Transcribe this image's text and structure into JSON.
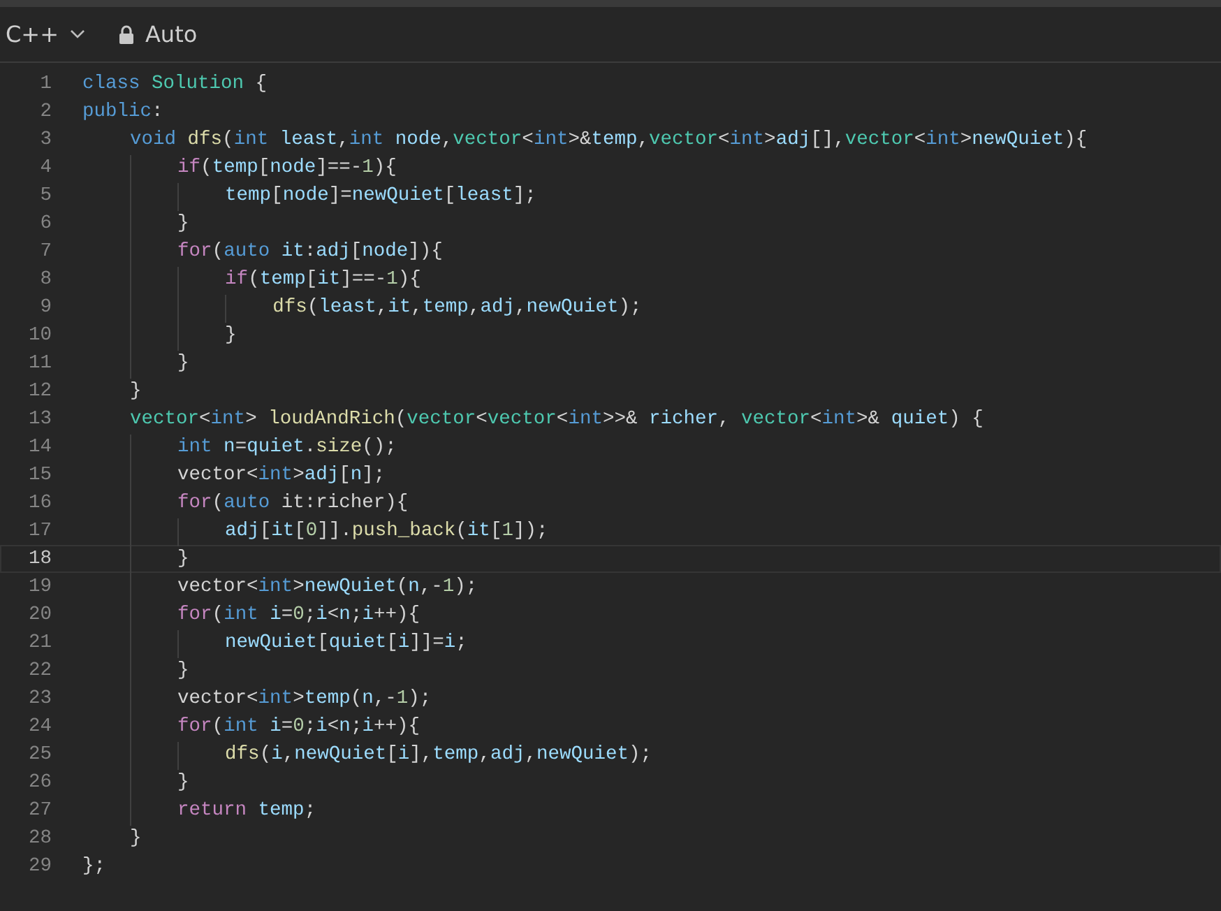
{
  "toolbar": {
    "language": "C++",
    "mode": "Auto"
  },
  "lines": [
    {
      "number": "1",
      "current": false,
      "tokens": [
        {
          "text": "class",
          "kind": "keyword"
        },
        {
          "text": " Solution",
          "kind": "type"
        },
        {
          "text": " {",
          "kind": "plain"
        }
      ]
    },
    {
      "number": "2",
      "current": false,
      "tokens": [
        {
          "text": "public",
          "kind": "keyword"
        },
        {
          "text": ":",
          "kind": "plain"
        }
      ]
    },
    {
      "number": "3",
      "current": false,
      "tokens": [
        {
          "text": "    void",
          "kind": "keyword"
        },
        {
          "text": " dfs",
          "kind": "function"
        },
        {
          "text": "(",
          "kind": "plain"
        },
        {
          "text": "int",
          "kind": "keyword"
        },
        {
          "text": " least",
          "kind": "variable"
        },
        {
          "text": ",",
          "kind": "plain"
        },
        {
          "text": "int",
          "kind": "keyword"
        },
        {
          "text": " node",
          "kind": "variable"
        },
        {
          "text": ",",
          "kind": "plain"
        },
        {
          "text": "vector",
          "kind": "type"
        },
        {
          "text": "<",
          "kind": "plain"
        },
        {
          "text": "int",
          "kind": "keyword"
        },
        {
          "text": ">&",
          "kind": "plain"
        },
        {
          "text": "temp",
          "kind": "variable"
        },
        {
          "text": ",",
          "kind": "plain"
        },
        {
          "text": "vector",
          "kind": "type"
        },
        {
          "text": "<",
          "kind": "plain"
        },
        {
          "text": "int",
          "kind": "keyword"
        },
        {
          "text": ">",
          "kind": "plain"
        },
        {
          "text": "adj",
          "kind": "variable"
        },
        {
          "text": "[],",
          "kind": "plain"
        },
        {
          "text": "vector",
          "kind": "type"
        },
        {
          "text": "<",
          "kind": "plain"
        },
        {
          "text": "int",
          "kind": "keyword"
        },
        {
          "text": ">",
          "kind": "plain"
        },
        {
          "text": "newQuiet",
          "kind": "variable"
        },
        {
          "text": "){",
          "kind": "plain"
        }
      ]
    },
    {
      "number": "4",
      "current": false,
      "tokens": [
        {
          "text": "        if",
          "kind": "control"
        },
        {
          "text": "(",
          "kind": "plain"
        },
        {
          "text": "temp",
          "kind": "variable"
        },
        {
          "text": "[",
          "kind": "plain"
        },
        {
          "text": "node",
          "kind": "variable"
        },
        {
          "text": "]==-",
          "kind": "plain"
        },
        {
          "text": "1",
          "kind": "number"
        },
        {
          "text": "){",
          "kind": "plain"
        }
      ]
    },
    {
      "number": "5",
      "current": false,
      "tokens": [
        {
          "text": "            temp",
          "kind": "variable"
        },
        {
          "text": "[",
          "kind": "plain"
        },
        {
          "text": "node",
          "kind": "variable"
        },
        {
          "text": "]=",
          "kind": "plain"
        },
        {
          "text": "newQuiet",
          "kind": "variable"
        },
        {
          "text": "[",
          "kind": "plain"
        },
        {
          "text": "least",
          "kind": "variable"
        },
        {
          "text": "];",
          "kind": "plain"
        }
      ]
    },
    {
      "number": "6",
      "current": false,
      "tokens": [
        {
          "text": "        }",
          "kind": "plain"
        }
      ]
    },
    {
      "number": "7",
      "current": false,
      "tokens": [
        {
          "text": "        for",
          "kind": "control"
        },
        {
          "text": "(",
          "kind": "plain"
        },
        {
          "text": "auto",
          "kind": "keyword"
        },
        {
          "text": " it",
          "kind": "variable"
        },
        {
          "text": ":",
          "kind": "plain"
        },
        {
          "text": "adj",
          "kind": "variable"
        },
        {
          "text": "[",
          "kind": "plain"
        },
        {
          "text": "node",
          "kind": "variable"
        },
        {
          "text": "]){",
          "kind": "plain"
        }
      ]
    },
    {
      "number": "8",
      "current": false,
      "tokens": [
        {
          "text": "            if",
          "kind": "control"
        },
        {
          "text": "(",
          "kind": "plain"
        },
        {
          "text": "temp",
          "kind": "variable"
        },
        {
          "text": "[",
          "kind": "plain"
        },
        {
          "text": "it",
          "kind": "variable"
        },
        {
          "text": "]==-",
          "kind": "plain"
        },
        {
          "text": "1",
          "kind": "number"
        },
        {
          "text": "){",
          "kind": "plain"
        }
      ]
    },
    {
      "number": "9",
      "current": false,
      "tokens": [
        {
          "text": "                dfs",
          "kind": "function"
        },
        {
          "text": "(",
          "kind": "plain"
        },
        {
          "text": "least",
          "kind": "variable"
        },
        {
          "text": ",",
          "kind": "plain"
        },
        {
          "text": "it",
          "kind": "variable"
        },
        {
          "text": ",",
          "kind": "plain"
        },
        {
          "text": "temp",
          "kind": "variable"
        },
        {
          "text": ",",
          "kind": "plain"
        },
        {
          "text": "adj",
          "kind": "variable"
        },
        {
          "text": ",",
          "kind": "plain"
        },
        {
          "text": "newQuiet",
          "kind": "variable"
        },
        {
          "text": ");",
          "kind": "plain"
        }
      ]
    },
    {
      "number": "10",
      "current": false,
      "tokens": [
        {
          "text": "            }",
          "kind": "plain"
        }
      ]
    },
    {
      "number": "11",
      "current": false,
      "tokens": [
        {
          "text": "        }",
          "kind": "plain"
        }
      ]
    },
    {
      "number": "12",
      "current": false,
      "tokens": [
        {
          "text": "    }",
          "kind": "plain"
        }
      ]
    },
    {
      "number": "13",
      "current": false,
      "tokens": [
        {
          "text": "    vector",
          "kind": "type"
        },
        {
          "text": "<",
          "kind": "plain"
        },
        {
          "text": "int",
          "kind": "keyword"
        },
        {
          "text": ">",
          "kind": "plain"
        },
        {
          "text": " loudAndRich",
          "kind": "function"
        },
        {
          "text": "(",
          "kind": "plain"
        },
        {
          "text": "vector",
          "kind": "type"
        },
        {
          "text": "<",
          "kind": "plain"
        },
        {
          "text": "vector",
          "kind": "type"
        },
        {
          "text": "<",
          "kind": "plain"
        },
        {
          "text": "int",
          "kind": "keyword"
        },
        {
          "text": ">>&",
          "kind": "plain"
        },
        {
          "text": " richer",
          "kind": "variable"
        },
        {
          "text": ",",
          "kind": "plain"
        },
        {
          "text": " vector",
          "kind": "type"
        },
        {
          "text": "<",
          "kind": "plain"
        },
        {
          "text": "int",
          "kind": "keyword"
        },
        {
          "text": ">&",
          "kind": "plain"
        },
        {
          "text": " quiet",
          "kind": "variable"
        },
        {
          "text": ") {",
          "kind": "plain"
        }
      ]
    },
    {
      "number": "14",
      "current": false,
      "tokens": [
        {
          "text": "        int",
          "kind": "keyword"
        },
        {
          "text": " n",
          "kind": "variable"
        },
        {
          "text": "=",
          "kind": "plain"
        },
        {
          "text": "quiet",
          "kind": "variable"
        },
        {
          "text": ".",
          "kind": "plain"
        },
        {
          "text": "size",
          "kind": "function"
        },
        {
          "text": "();",
          "kind": "plain"
        }
      ]
    },
    {
      "number": "15",
      "current": false,
      "tokens": [
        {
          "text": "        vector<",
          "kind": "plain"
        },
        {
          "text": "int",
          "kind": "keyword"
        },
        {
          "text": ">",
          "kind": "plain"
        },
        {
          "text": "adj",
          "kind": "variable"
        },
        {
          "text": "[",
          "kind": "plain"
        },
        {
          "text": "n",
          "kind": "variable"
        },
        {
          "text": "];",
          "kind": "plain"
        }
      ]
    },
    {
      "number": "16",
      "current": false,
      "tokens": [
        {
          "text": "        for",
          "kind": "control"
        },
        {
          "text": "(",
          "kind": "plain"
        },
        {
          "text": "auto",
          "kind": "keyword"
        },
        {
          "text": " it:richer){",
          "kind": "plain"
        }
      ]
    },
    {
      "number": "17",
      "current": false,
      "tokens": [
        {
          "text": "            adj",
          "kind": "variable"
        },
        {
          "text": "[",
          "kind": "plain"
        },
        {
          "text": "it",
          "kind": "variable"
        },
        {
          "text": "[",
          "kind": "plain"
        },
        {
          "text": "0",
          "kind": "number"
        },
        {
          "text": "]].",
          "kind": "plain"
        },
        {
          "text": "push_back",
          "kind": "function"
        },
        {
          "text": "(",
          "kind": "plain"
        },
        {
          "text": "it",
          "kind": "variable"
        },
        {
          "text": "[",
          "kind": "plain"
        },
        {
          "text": "1",
          "kind": "number"
        },
        {
          "text": "]);",
          "kind": "plain"
        }
      ]
    },
    {
      "number": "18",
      "current": true,
      "tokens": [
        {
          "text": "        }",
          "kind": "plain"
        }
      ]
    },
    {
      "number": "19",
      "current": false,
      "tokens": [
        {
          "text": "        vector<",
          "kind": "plain"
        },
        {
          "text": "int",
          "kind": "keyword"
        },
        {
          "text": ">",
          "kind": "plain"
        },
        {
          "text": "newQuiet",
          "kind": "variable"
        },
        {
          "text": "(",
          "kind": "plain"
        },
        {
          "text": "n",
          "kind": "variable"
        },
        {
          "text": ",-",
          "kind": "plain"
        },
        {
          "text": "1",
          "kind": "number"
        },
        {
          "text": ");",
          "kind": "plain"
        }
      ]
    },
    {
      "number": "20",
      "current": false,
      "tokens": [
        {
          "text": "        for",
          "kind": "control"
        },
        {
          "text": "(",
          "kind": "plain"
        },
        {
          "text": "int",
          "kind": "keyword"
        },
        {
          "text": " i",
          "kind": "variable"
        },
        {
          "text": "=",
          "kind": "plain"
        },
        {
          "text": "0",
          "kind": "number"
        },
        {
          "text": ";",
          "kind": "plain"
        },
        {
          "text": "i",
          "kind": "variable"
        },
        {
          "text": "<",
          "kind": "plain"
        },
        {
          "text": "n",
          "kind": "variable"
        },
        {
          "text": ";",
          "kind": "plain"
        },
        {
          "text": "i",
          "kind": "variable"
        },
        {
          "text": "++){",
          "kind": "plain"
        }
      ]
    },
    {
      "number": "21",
      "current": false,
      "tokens": [
        {
          "text": "            newQuiet",
          "kind": "variable"
        },
        {
          "text": "[",
          "kind": "plain"
        },
        {
          "text": "quiet",
          "kind": "variable"
        },
        {
          "text": "[",
          "kind": "plain"
        },
        {
          "text": "i",
          "kind": "variable"
        },
        {
          "text": "]]=",
          "kind": "plain"
        },
        {
          "text": "i",
          "kind": "variable"
        },
        {
          "text": ";",
          "kind": "plain"
        }
      ]
    },
    {
      "number": "22",
      "current": false,
      "tokens": [
        {
          "text": "        }",
          "kind": "plain"
        }
      ]
    },
    {
      "number": "23",
      "current": false,
      "tokens": [
        {
          "text": "        vector<",
          "kind": "plain"
        },
        {
          "text": "int",
          "kind": "keyword"
        },
        {
          "text": ">",
          "kind": "plain"
        },
        {
          "text": "temp",
          "kind": "variable"
        },
        {
          "text": "(",
          "kind": "plain"
        },
        {
          "text": "n",
          "kind": "variable"
        },
        {
          "text": ",-",
          "kind": "plain"
        },
        {
          "text": "1",
          "kind": "number"
        },
        {
          "text": ");",
          "kind": "plain"
        }
      ]
    },
    {
      "number": "24",
      "current": false,
      "tokens": [
        {
          "text": "        for",
          "kind": "control"
        },
        {
          "text": "(",
          "kind": "plain"
        },
        {
          "text": "int",
          "kind": "keyword"
        },
        {
          "text": " i",
          "kind": "variable"
        },
        {
          "text": "=",
          "kind": "plain"
        },
        {
          "text": "0",
          "kind": "number"
        },
        {
          "text": ";",
          "kind": "plain"
        },
        {
          "text": "i",
          "kind": "variable"
        },
        {
          "text": "<",
          "kind": "plain"
        },
        {
          "text": "n",
          "kind": "variable"
        },
        {
          "text": ";",
          "kind": "plain"
        },
        {
          "text": "i",
          "kind": "variable"
        },
        {
          "text": "++){",
          "kind": "plain"
        }
      ]
    },
    {
      "number": "25",
      "current": false,
      "tokens": [
        {
          "text": "            dfs",
          "kind": "function"
        },
        {
          "text": "(",
          "kind": "plain"
        },
        {
          "text": "i",
          "kind": "variable"
        },
        {
          "text": ",",
          "kind": "plain"
        },
        {
          "text": "newQuiet",
          "kind": "variable"
        },
        {
          "text": "[",
          "kind": "plain"
        },
        {
          "text": "i",
          "kind": "variable"
        },
        {
          "text": "],",
          "kind": "plain"
        },
        {
          "text": "temp",
          "kind": "variable"
        },
        {
          "text": ",",
          "kind": "plain"
        },
        {
          "text": "adj",
          "kind": "variable"
        },
        {
          "text": ",",
          "kind": "plain"
        },
        {
          "text": "newQuiet",
          "kind": "variable"
        },
        {
          "text": ");",
          "kind": "plain"
        }
      ]
    },
    {
      "number": "26",
      "current": false,
      "tokens": [
        {
          "text": "        }",
          "kind": "plain"
        }
      ]
    },
    {
      "number": "27",
      "current": false,
      "tokens": [
        {
          "text": "        return",
          "kind": "control"
        },
        {
          "text": " temp",
          "kind": "variable"
        },
        {
          "text": ";",
          "kind": "plain"
        }
      ]
    },
    {
      "number": "28",
      "current": false,
      "tokens": [
        {
          "text": "    }",
          "kind": "plain"
        }
      ]
    },
    {
      "number": "29",
      "current": false,
      "tokens": [
        {
          "text": "};",
          "kind": "plain"
        }
      ]
    }
  ]
}
